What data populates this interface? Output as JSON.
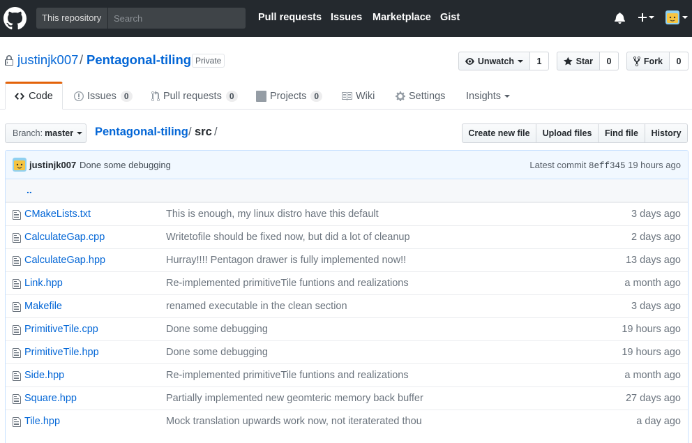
{
  "header": {
    "search_scope": "This repository",
    "search_placeholder": "Search",
    "nav": [
      "Pull requests",
      "Issues",
      "Marketplace",
      "Gist"
    ],
    "icons": [
      "github-mark",
      "bell",
      "plus",
      "avatar"
    ]
  },
  "repo": {
    "owner": "justinjk007",
    "separator": "/",
    "name": "Pentagonal-tiling",
    "visibility": "Private"
  },
  "social": {
    "watch_label": "Unwatch",
    "watch_count": "1",
    "star_label": "Star",
    "star_count": "0",
    "fork_label": "Fork",
    "fork_count": "0"
  },
  "tabs": {
    "code": "Code",
    "issues": "Issues",
    "issues_count": "0",
    "pulls": "Pull requests",
    "pulls_count": "0",
    "projects": "Projects",
    "projects_count": "0",
    "wiki": "Wiki",
    "settings": "Settings",
    "insights": "Insights"
  },
  "branch": {
    "label": "Branch:",
    "value": "master"
  },
  "breadcrumb": {
    "root": "Pentagonal-tiling",
    "sep1": "/",
    "dir": "src",
    "sep2": "/"
  },
  "file_buttons": [
    "Create new file",
    "Upload files",
    "Find file",
    "History"
  ],
  "commit": {
    "author": "justinjk007",
    "message": "Done some debugging",
    "latest_label": "Latest commit",
    "sha": "8eff345",
    "age": "19 hours ago"
  },
  "updir": "..",
  "files": [
    {
      "name": "CMakeLists.txt",
      "message": "This is enough, my linux distro have this default",
      "age": "3 days ago"
    },
    {
      "name": "CalculateGap.cpp",
      "message": "Writetofile should be fixed now, but did a lot of cleanup",
      "age": "2 days ago"
    },
    {
      "name": "CalculateGap.hpp",
      "message": "Hurray!!!! Pentagon drawer is fully implemented now!!",
      "age": "13 days ago"
    },
    {
      "name": "Link.hpp",
      "message": "Re-implemented primitiveTile funtions and realizations",
      "age": "a month ago"
    },
    {
      "name": "Makefile",
      "message": "renamed executable in the clean section",
      "age": "3 days ago"
    },
    {
      "name": "PrimitiveTile.cpp",
      "message": "Done some debugging",
      "age": "19 hours ago"
    },
    {
      "name": "PrimitiveTile.hpp",
      "message": "Done some debugging",
      "age": "19 hours ago"
    },
    {
      "name": "Side.hpp",
      "message": "Re-implemented primitiveTile funtions and realizations",
      "age": "a month ago"
    },
    {
      "name": "Square.hpp",
      "message": "Partially implemented new geomteric memory back buffer",
      "age": "27 days ago"
    },
    {
      "name": "Tile.hpp",
      "message": "Mock translation upwards work now, not iteraterated thou",
      "age": "a day ago"
    }
  ]
}
